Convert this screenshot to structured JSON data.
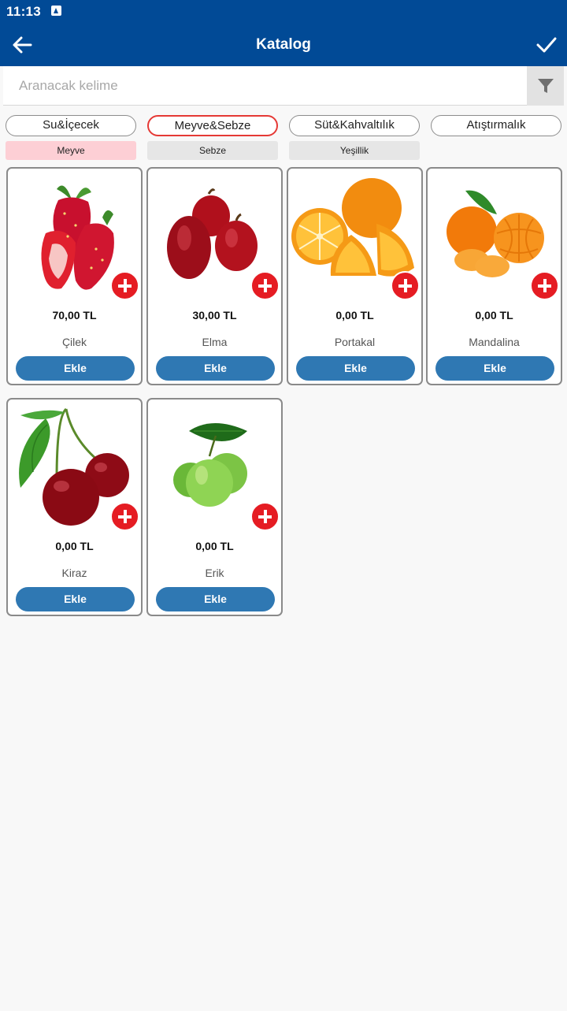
{
  "status_bar": {
    "time": "11:13"
  },
  "header": {
    "title": "Katalog"
  },
  "search": {
    "placeholder": "Aranacak kelime"
  },
  "categories": [
    {
      "label": "Su&İçecek",
      "active": false
    },
    {
      "label": "Meyve&Sebze",
      "active": true
    },
    {
      "label": "Süt&Kahvaltılık",
      "active": false
    },
    {
      "label": "Atıştırmalık",
      "active": false
    }
  ],
  "subcategories": [
    {
      "label": "Meyve",
      "active": true
    },
    {
      "label": "Sebze",
      "active": false
    },
    {
      "label": "Yeşillik",
      "active": false
    }
  ],
  "colors": {
    "primary": "#014a96",
    "accent_red": "#e51c23",
    "button_blue": "#2f78b3",
    "active_sub_bg": "#fdcfd5"
  },
  "products": [
    {
      "name": "Çilek",
      "price": "70,00 TL",
      "button": "Ekle",
      "image": "strawberry-image"
    },
    {
      "name": "Elma",
      "price": "30,00 TL",
      "button": "Ekle",
      "image": "apple-image"
    },
    {
      "name": "Portakal",
      "price": "0,00 TL",
      "button": "Ekle",
      "image": "orange-image"
    },
    {
      "name": "Mandalina",
      "price": "0,00 TL",
      "button": "Ekle",
      "image": "mandarin-image"
    },
    {
      "name": "Kiraz",
      "price": "0,00 TL",
      "button": "Ekle",
      "image": "cherry-image"
    },
    {
      "name": "Erik",
      "price": "0,00 TL",
      "button": "Ekle",
      "image": "green-plum-image"
    }
  ]
}
